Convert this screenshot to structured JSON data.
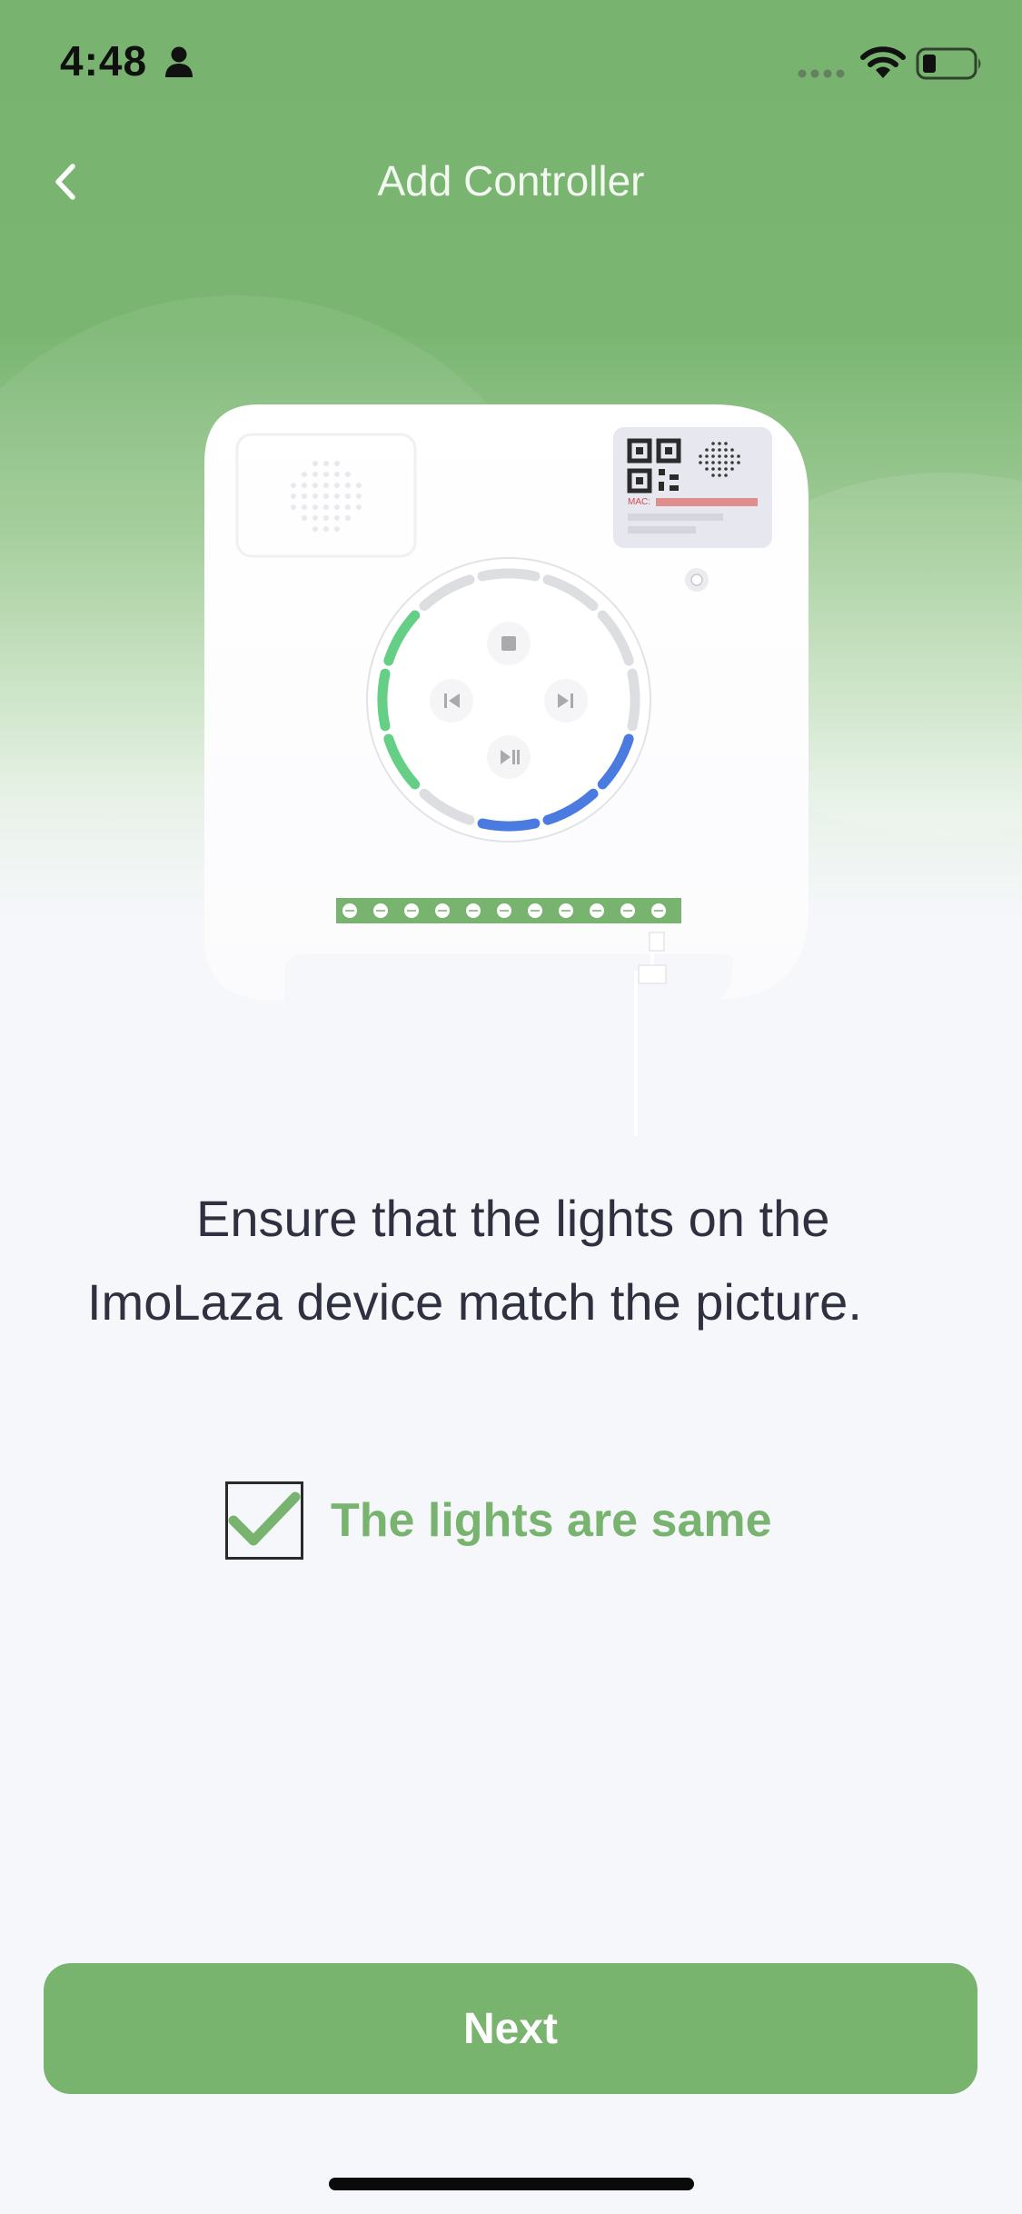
{
  "status_bar": {
    "time": "4:48",
    "icons": [
      "person-icon",
      "signal-dots-icon",
      "wifi-icon",
      "battery-icon"
    ]
  },
  "nav": {
    "title": "Add Controller",
    "back_icon": "chevron-left-icon"
  },
  "illustration": {
    "label_text": "MAC:",
    "led_colors": {
      "off": "#dddee2",
      "green": "#65cf86",
      "blue": "#4a7be0"
    }
  },
  "instruction": {
    "text": "Ensure that the lights on the ImoLaza device match the picture."
  },
  "confirm": {
    "checked": true,
    "label": "The lights are same"
  },
  "footer": {
    "next_label": "Next"
  },
  "colors": {
    "accent": "#78b46f",
    "text": "#2f3140",
    "background": "#f6f7fb"
  }
}
